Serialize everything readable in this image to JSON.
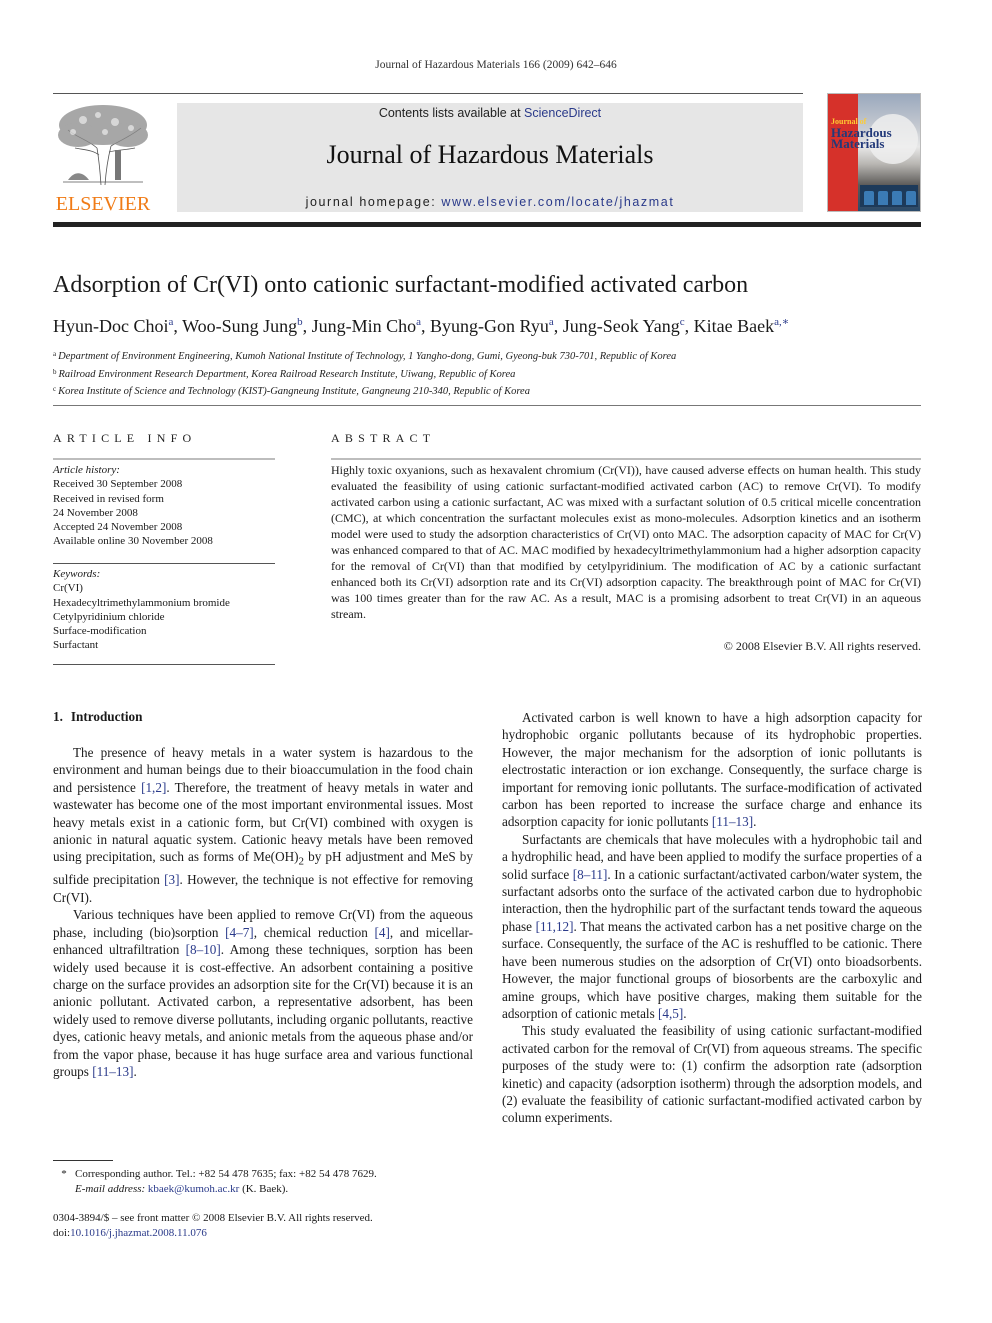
{
  "running_head": "Journal of Hazardous Materials 166 (2009) 642–646",
  "banner": {
    "contents_prefix": "Contents lists available at ",
    "contents_link": "ScienceDirect",
    "journal_name": "Journal of Hazardous Materials",
    "homepage_prefix": "journal homepage: ",
    "homepage_link": "www.elsevier.com/locate/jhazmat"
  },
  "logo": {
    "publisher": "ELSEVIER",
    "color": "#f07b16"
  },
  "cover": {
    "line1": "Journal of",
    "line2": "Hazardous",
    "line3": "Materials"
  },
  "article": {
    "title": "Adsorption of Cr(VI) onto cationic surfactant-modified activated carbon",
    "authors": [
      {
        "name": "Hyun-Doc Choi",
        "sup": "a"
      },
      {
        "name": "Woo-Sung Jung",
        "sup": "b"
      },
      {
        "name": "Jung-Min Cho",
        "sup": "a"
      },
      {
        "name": "Byung-Gon Ryu",
        "sup": "a"
      },
      {
        "name": "Jung-Seok Yang",
        "sup": "c"
      },
      {
        "name": "Kitae Baek",
        "sup": "a,∗"
      }
    ],
    "affiliations": [
      {
        "sup": "a",
        "text": "Department of Environment Engineering, Kumoh National Institute of Technology, 1 Yangho-dong, Gumi, Gyeong-buk 730-701, Republic of Korea"
      },
      {
        "sup": "b",
        "text": "Railroad Environment Research Department, Korea Railroad Research Institute, Uiwang, Republic of Korea"
      },
      {
        "sup": "c",
        "text": "Korea Institute of Science and Technology (KIST)-Gangneung Institute, Gangneung 210-340, Republic of Korea"
      }
    ]
  },
  "article_info": {
    "heading": "ARTICLE INFO",
    "history_label": "Article history:",
    "history": [
      "Received 30 September 2008",
      "Received in revised form",
      "24 November 2008",
      "Accepted 24 November 2008",
      "Available online 30 November 2008"
    ],
    "keywords_label": "Keywords:",
    "keywords": [
      "Cr(VI)",
      "Hexadecyltrimethylammonium bromide",
      "Cetylpyridinium chloride",
      "Surface-modification",
      "Surfactant"
    ]
  },
  "abstract": {
    "heading": "ABSTRACT",
    "text": "Highly toxic oxyanions, such as hexavalent chromium (Cr(VI)), have caused adverse effects on human health. This study evaluated the feasibility of using cationic surfactant-modified activated carbon (AC) to remove Cr(VI). To modify activated carbon using a cationic surfactant, AC was mixed with a surfactant solution of 0.5 critical micelle concentration (CMC), at which concentration the surfactant molecules exist as mono-molecules. Adsorption kinetics and an isotherm model were used to study the adsorption characteristics of Cr(VI) onto MAC. The adsorption capacity of MAC for Cr(V) was enhanced compared to that of AC. MAC modified by hexadecyltrimethylammonium had a higher adsorption capacity for the removal of Cr(VI) than that modified by cetylpyridinium. The modification of AC by a cationic surfactant enhanced both its Cr(VI) adsorption rate and its Cr(VI) adsorption capacity. The breakthrough point of MAC for Cr(VI) was 100 times greater than for the raw AC. As a result, MAC is a promising adsorbent to treat Cr(VI) in an aqueous stream.",
    "copyright": "© 2008 Elsevier B.V. All rights reserved."
  },
  "introduction": {
    "number": "1.",
    "heading": "Introduction",
    "left_paragraphs": [
      {
        "parts": [
          {
            "t": "The presence of heavy metals in a water system is hazardous to the environment and human beings due to their bioaccumulation in the food chain and persistence "
          },
          {
            "ref": "[1,2]"
          },
          {
            "t": ". Therefore, the treatment of heavy metals in water and wastewater has become one of the most important environmental issues. Most heavy metals exist in a cationic form, but Cr(VI) combined with oxygen is anionic in natural aquatic system. Cationic heavy metals have been removed using precipitation, such as forms of Me(OH)"
          },
          {
            "sub": "2"
          },
          {
            "t": " by pH adjustment and MeS by sulfide precipitation "
          },
          {
            "ref": "[3]"
          },
          {
            "t": ". However, the technique is not effective for removing Cr(VI)."
          }
        ]
      },
      {
        "parts": [
          {
            "t": "Various techniques have been applied to remove Cr(VI) from the aqueous phase, including (bio)sorption "
          },
          {
            "ref": "[4–7]"
          },
          {
            "t": ", chemical reduction "
          },
          {
            "ref": "[4]"
          },
          {
            "t": ", and micellar-enhanced ultrafiltration "
          },
          {
            "ref": "[8–10]"
          },
          {
            "t": ". Among these techniques, sorption has been widely used because it is cost-effective. An adsorbent containing a positive charge on the surface provides an adsorption site for the Cr(VI) because it is an anionic pollutant. Activated carbon, a representative adsorbent, has been widely used to remove diverse pollutants, including organic pollutants, reactive dyes, cationic heavy metals, and anionic metals from the aqueous phase and/or from the vapor phase, because it has huge surface area and various functional groups "
          },
          {
            "ref": "[11–13]"
          },
          {
            "t": "."
          }
        ]
      }
    ],
    "right_paragraphs": [
      {
        "parts": [
          {
            "t": "Activated carbon is well known to have a high adsorption capacity for hydrophobic organic pollutants because of its hydrophobic properties. However, the major mechanism for the adsorption of ionic pollutants is electrostatic interaction or ion exchange. Consequently, the surface charge is important for removing ionic pollutants. The surface-modification of activated carbon has been reported to increase the surface charge and enhance its adsorption capacity for ionic pollutants "
          },
          {
            "ref": "[11–13]"
          },
          {
            "t": "."
          }
        ]
      },
      {
        "parts": [
          {
            "t": "Surfactants are chemicals that have molecules with a hydrophobic tail and a hydrophilic head, and have been applied to modify the surface properties of a solid surface "
          },
          {
            "ref": "[8–11]"
          },
          {
            "t": ". In a cationic surfactant/activated carbon/water system, the surfactant adsorbs onto the surface of the activated carbon due to hydrophobic interaction, then the hydrophilic part of the surfactant tends toward the aqueous phase "
          },
          {
            "ref": "[11,12]"
          },
          {
            "t": ". That means the activated carbon has a net positive charge on the surface. Consequently, the surface of the AC is reshuffled to be cationic. There have been numerous studies on the adsorption of Cr(VI) onto bioadsorbents. However, the major functional groups of biosorbents are the carboxylic and amine groups, which have positive charges, making them suitable for the adsorption of cationic metals "
          },
          {
            "ref": "[4,5]"
          },
          {
            "t": "."
          }
        ]
      },
      {
        "parts": [
          {
            "t": "This study evaluated the feasibility of using cationic surfactant-modified activated carbon for the removal of Cr(VI) from aqueous streams. The specific purposes of the study were to: (1) confirm the adsorption rate (adsorption kinetic) and capacity (adsorption isotherm) through the adsorption models, and (2) evaluate the feasibility of cationic surfactant-modified activated carbon by column experiments."
          }
        ]
      }
    ]
  },
  "footnote": {
    "star": "*",
    "corresponding": "Corresponding author. Tel.: +82 54 478 7635; fax: +82 54 478 7629.",
    "email_label": "E-mail address: ",
    "email": "kbaek@kumoh.ac.kr",
    "email_suffix": " (K. Baek)."
  },
  "footer": {
    "issn_line": "0304-3894/$ – see front matter © 2008 Elsevier B.V. All rights reserved.",
    "doi_label": "doi:",
    "doi": "10.1016/j.jhazmat.2008.11.076"
  },
  "colors": {
    "link": "#2a3a8a",
    "banner_bg": "#e6e6e6",
    "elsevier_orange": "#f07b16"
  }
}
